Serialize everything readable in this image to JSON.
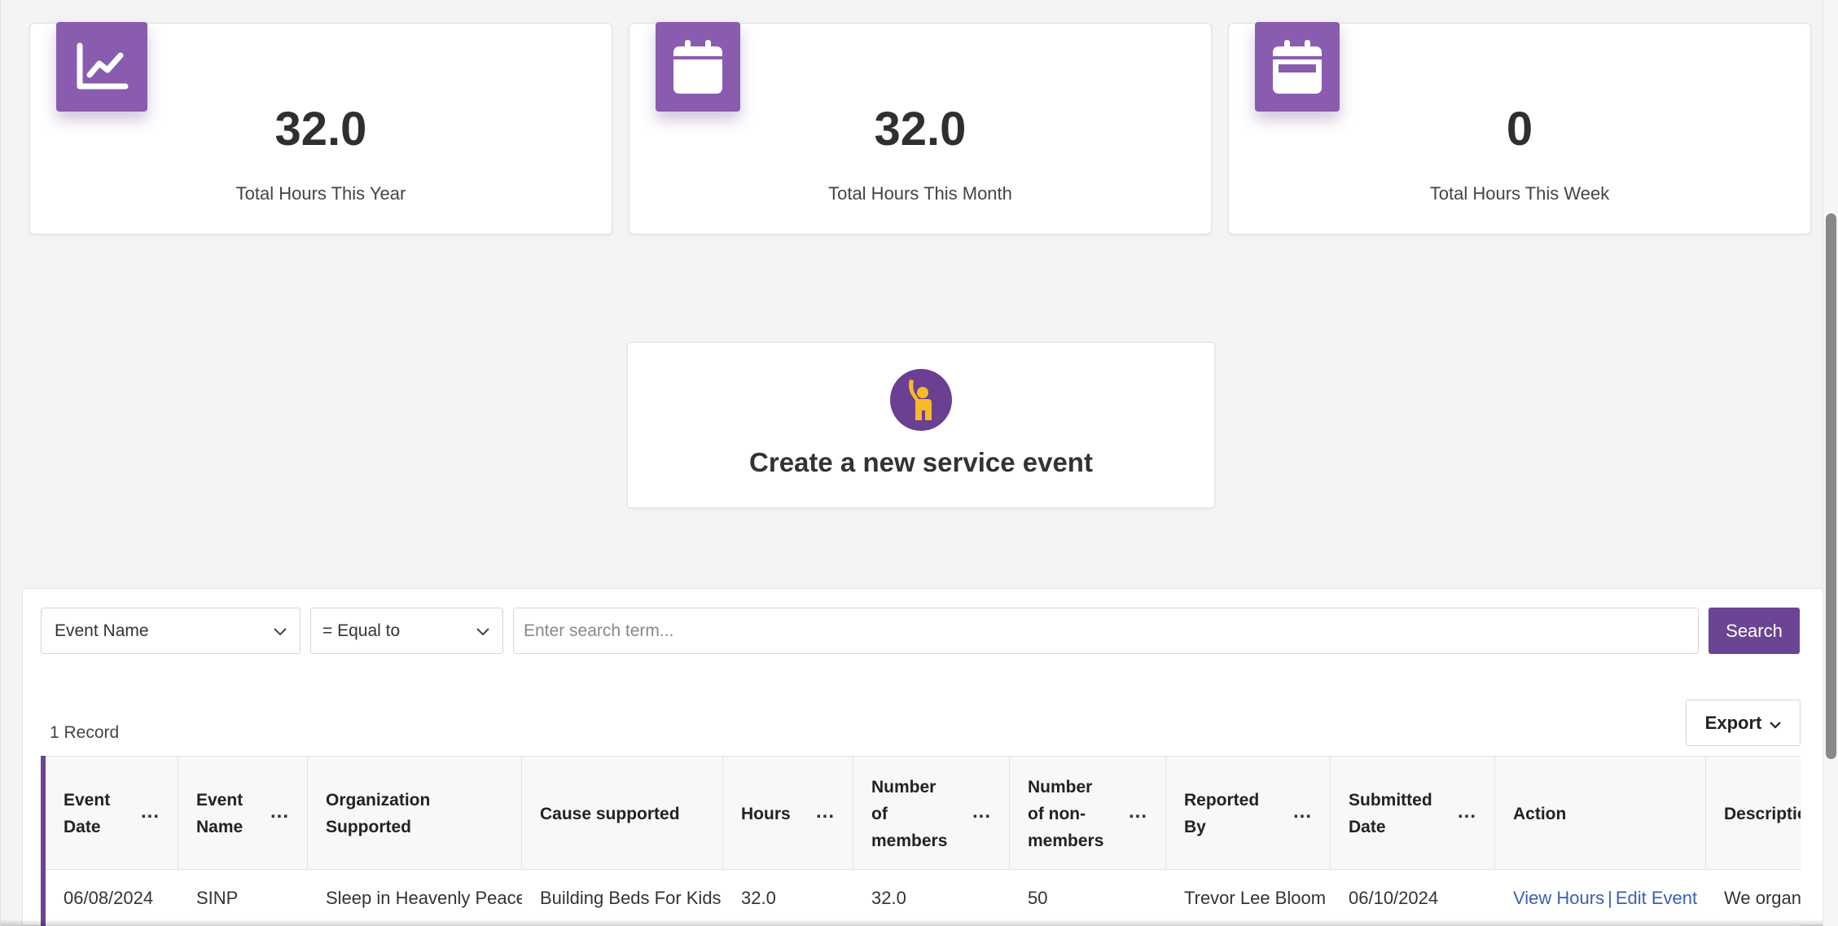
{
  "stats": [
    {
      "value": "32.0",
      "label": "Total Hours This Year",
      "icon": "line-chart-icon"
    },
    {
      "value": "32.0",
      "label": "Total Hours This Month",
      "icon": "calendar-icon"
    },
    {
      "value": "0",
      "label": "Total Hours This Week",
      "icon": "calendar-week-icon"
    }
  ],
  "create_event": {
    "title": "Create a new service event",
    "icon": "raised-hand-person-icon"
  },
  "filters": {
    "field_value": "Event Name",
    "operator_value": "= Equal to",
    "search_placeholder": "Enter search term...",
    "search_label": "Search"
  },
  "record_count": "1 Record",
  "export_label": "Export",
  "table": {
    "columns": [
      {
        "label": "Event Date",
        "menu": "..."
      },
      {
        "label": "Event Name",
        "menu": "..."
      },
      {
        "label": "Organization Supported",
        "menu": ""
      },
      {
        "label": "Cause supported",
        "menu": ""
      },
      {
        "label": "Hours",
        "menu": "..."
      },
      {
        "label": "Number of members",
        "menu": "..."
      },
      {
        "label": "Number of non-members",
        "menu": "..."
      },
      {
        "label": "Reported By",
        "menu": "..."
      },
      {
        "label": "Submitted Date",
        "menu": "..."
      },
      {
        "label": "Action",
        "menu": ""
      },
      {
        "label": "Description",
        "menu": ""
      }
    ],
    "rows": [
      {
        "event_date": "06/08/2024",
        "event_name": "SINP",
        "organization": "Sleep in Heavenly Peace",
        "cause": "Building Beds For Kids",
        "hours": "32.0",
        "members": "32.0",
        "non_members": "50",
        "reported_by": "Trevor Lee Bloom",
        "submitted_date": "06/10/2024",
        "action_view": "View Hours",
        "action_sep": "|",
        "action_edit": "Edit Event",
        "description": "We organi"
      }
    ]
  },
  "colors": {
    "accent": "#8a5cb0",
    "button": "#6b4494",
    "link": "#3b5fb5"
  }
}
